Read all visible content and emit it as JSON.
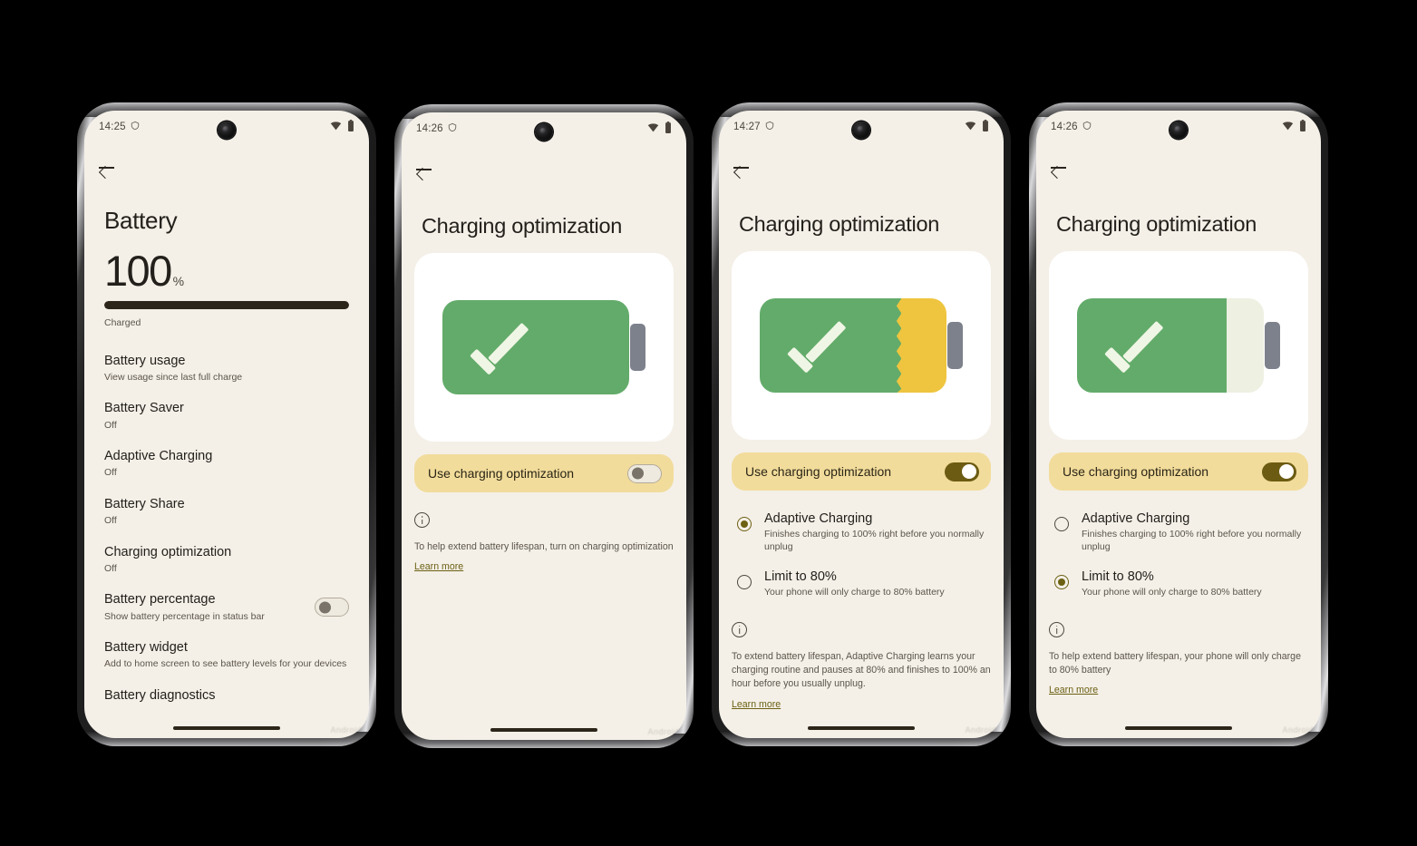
{
  "meta": {
    "background": "#000000",
    "screen_bg": "#f4f0e8",
    "accent_yellow": "#f2dc9b",
    "accent_olive": "#6c6013",
    "battery_green": "#63ab6a",
    "battery_yellow": "#efc53f",
    "battery_empty": "#eef0e2",
    "nub_gray": "#7d818c",
    "watermark": "Android"
  },
  "phones": [
    {
      "id": "phone-battery-settings",
      "status": {
        "time": "14:25",
        "shield_icon": "shield-icon",
        "wifi_icon": "wifi-icon",
        "battery_icon": "battery-icon"
      },
      "back_icon": "back-arrow-icon",
      "title": "Battery",
      "battery": {
        "percent": "100",
        "symbol": "%",
        "fill_percent": 100,
        "status_label": "Charged"
      },
      "items": [
        {
          "title": "Battery usage",
          "sub": "View usage since last full charge",
          "toggle": null
        },
        {
          "title": "Battery Saver",
          "sub": "Off",
          "toggle": null
        },
        {
          "title": "Adaptive Charging",
          "sub": "Off",
          "toggle": null
        },
        {
          "title": "Battery Share",
          "sub": "Off",
          "toggle": null
        },
        {
          "title": "Charging optimization",
          "sub": "Off",
          "toggle": null
        },
        {
          "title": "Battery percentage",
          "sub": "Show battery percentage in status bar",
          "toggle": "off"
        },
        {
          "title": "Battery widget",
          "sub": "Add to home screen to see battery levels for your devices",
          "toggle": null
        },
        {
          "title": "Battery diagnostics",
          "sub": "",
          "toggle": null
        }
      ]
    },
    {
      "id": "phone-charging-optimization-off",
      "status": {
        "time": "14:26"
      },
      "title": "Charging optimization",
      "art": {
        "green_percent": 100,
        "rest_type": "none",
        "zigzag": false,
        "check": true
      },
      "opt_bar": {
        "label": "Use charging optimization",
        "state": "off"
      },
      "radios": [],
      "info": {
        "text": "To help extend battery lifespan, turn on charging optimization",
        "learn_more": "Learn more"
      }
    },
    {
      "id": "phone-charging-optimization-adaptive",
      "status": {
        "time": "14:27"
      },
      "title": "Charging optimization",
      "art": {
        "green_percent": 72,
        "rest_type": "yellow",
        "zigzag": true,
        "check": true
      },
      "opt_bar": {
        "label": "Use charging optimization",
        "state": "on"
      },
      "radios": [
        {
          "title": "Adaptive Charging",
          "sub": "Finishes charging to 100% right before you normally unplug",
          "selected": true
        },
        {
          "title": "Limit to 80%",
          "sub": "Your phone will only charge to 80% battery",
          "selected": false
        }
      ],
      "info": {
        "text": "To extend battery lifespan, Adaptive Charging learns your charging routine and pauses at 80% and finishes to 100% an hour before you usually unplug.",
        "learn_more": "Learn more"
      }
    },
    {
      "id": "phone-charging-optimization-limit80",
      "status": {
        "time": "14:26"
      },
      "title": "Charging optimization",
      "art": {
        "green_percent": 80,
        "rest_type": "empty",
        "zigzag": false,
        "check": true
      },
      "opt_bar": {
        "label": "Use charging optimization",
        "state": "on"
      },
      "radios": [
        {
          "title": "Adaptive Charging",
          "sub": "Finishes charging to 100% right before you normally unplug",
          "selected": false
        },
        {
          "title": "Limit to 80%",
          "sub": "Your phone will only charge to 80% battery",
          "selected": true
        }
      ],
      "info": {
        "text": "To help extend battery lifespan, your phone will only charge to 80% battery",
        "learn_more": "Learn more"
      }
    }
  ]
}
